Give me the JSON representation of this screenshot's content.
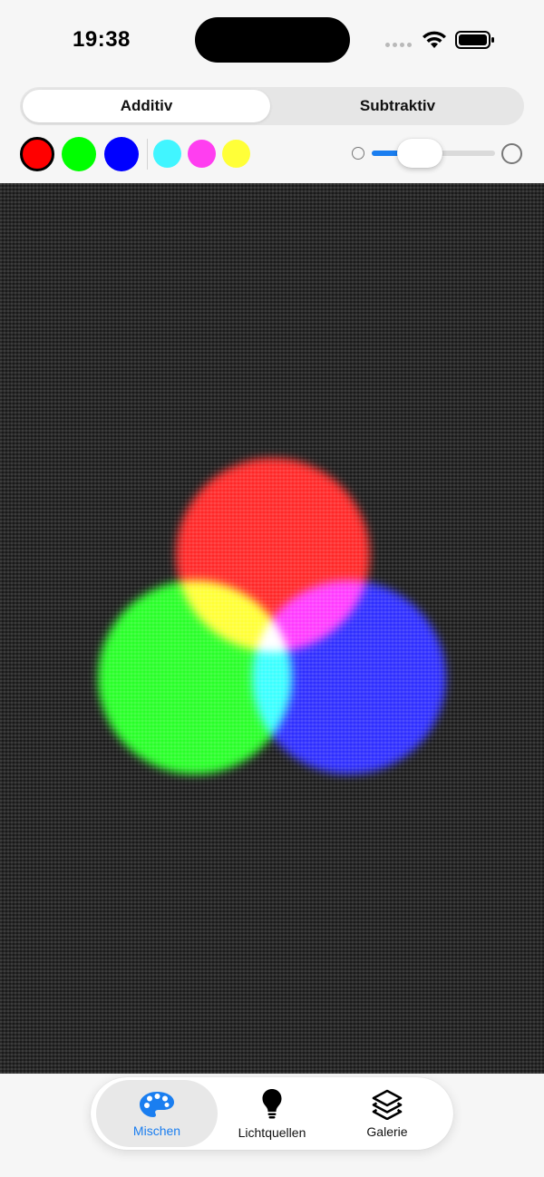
{
  "status_bar": {
    "time": "19:38"
  },
  "mode_selector": {
    "options": [
      "Additiv",
      "Subtraktiv"
    ],
    "selected": "Additiv"
  },
  "swatches": {
    "primary": [
      {
        "name": "red",
        "color": "#ff0000",
        "selected": true
      },
      {
        "name": "green",
        "color": "#00ff00",
        "selected": false
      },
      {
        "name": "blue",
        "color": "#0000ff",
        "selected": false
      }
    ],
    "secondary": [
      {
        "name": "cyan",
        "color": "#41f5ff"
      },
      {
        "name": "magenta",
        "color": "#ff3ef0"
      },
      {
        "name": "yellow",
        "color": "#ffff38"
      }
    ]
  },
  "size_slider": {
    "value_fraction": 0.33
  },
  "canvas": {
    "lights": [
      {
        "name": "red-light",
        "color": "#ff1010"
      },
      {
        "name": "green-light",
        "color": "#10ff10"
      },
      {
        "name": "blue-light",
        "color": "#1717ff"
      }
    ]
  },
  "tab_bar": {
    "items": [
      {
        "label": "Mischen",
        "icon": "palette-icon",
        "active": true
      },
      {
        "label": "Lichtquellen",
        "icon": "lightbulb-icon",
        "active": false
      },
      {
        "label": "Galerie",
        "icon": "layers-icon",
        "active": false
      }
    ],
    "accent_color": "#1a7ef0"
  }
}
